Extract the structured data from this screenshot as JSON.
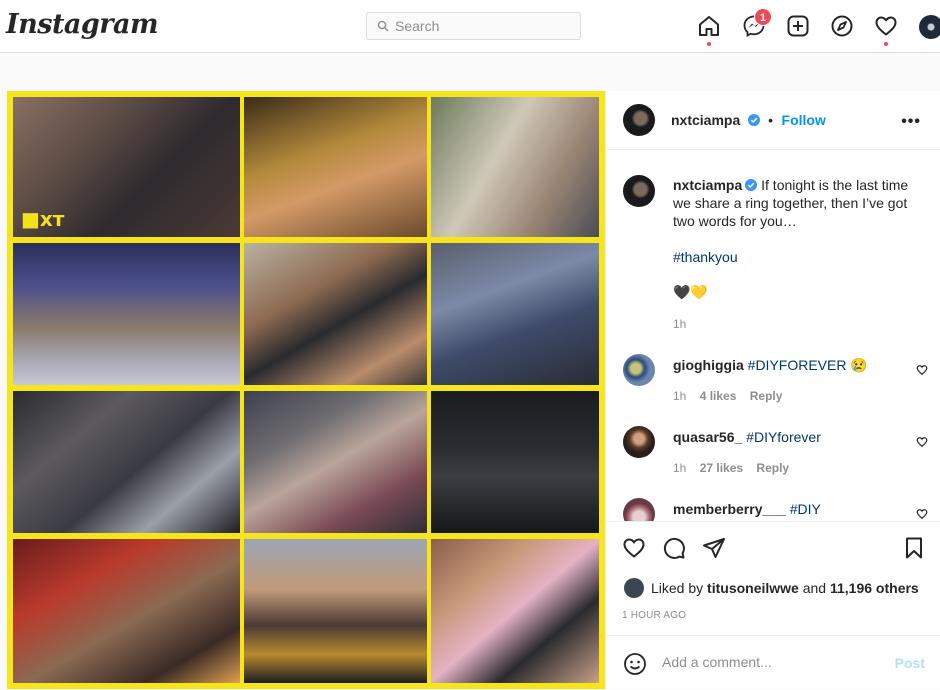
{
  "header": {
    "logo": "Instagram",
    "search_placeholder": "Search",
    "messages_badge": "1"
  },
  "post": {
    "author": "nxtciampa",
    "follow_label": "Follow",
    "caption_user": "nxtciampa",
    "caption_text": "If tonight is the last time we share a ring together, then I’ve got two words for you…",
    "caption_hashtag": "#thankyou",
    "caption_emoji": "🖤💛",
    "caption_time": "1h",
    "comments": [
      {
        "user": "gioghiggia",
        "text": "#DIYFOREVER 😢",
        "time": "1h",
        "likes": "4 likes",
        "reply": "Reply"
      },
      {
        "user": "quasar56_",
        "text": "#DIYforever",
        "time": "1h",
        "likes": "27 likes",
        "reply": "Reply"
      },
      {
        "user": "memberberry___",
        "text": "#DIY",
        "time": "",
        "likes": "",
        "reply": ""
      }
    ],
    "liked_by_prefix": "Liked by ",
    "liked_by_user": "titusoneilwwe",
    "liked_by_mid": " and ",
    "liked_by_count": "11,196 others",
    "time_ago": "1 HOUR AGO",
    "comment_placeholder": "Add a comment...",
    "post_label": "Post"
  },
  "colors": {
    "accent": "#0095f6",
    "notification": "#ed4956",
    "collage_border": "#f5e51a"
  }
}
